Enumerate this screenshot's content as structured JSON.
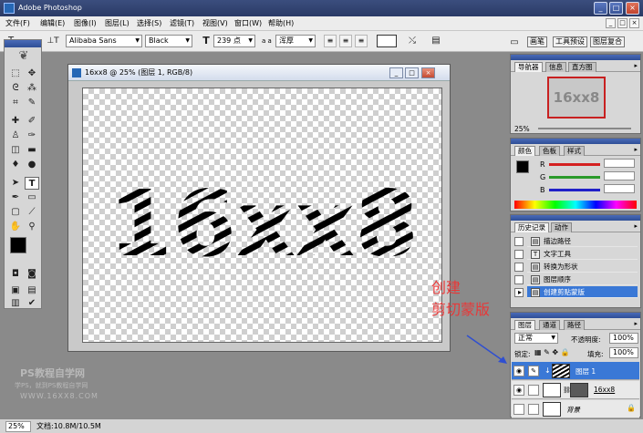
{
  "app": {
    "title": "Adobe Photoshop"
  },
  "menu": [
    "文件(F)",
    "编辑(E)",
    "图像(I)",
    "图层(L)",
    "选择(S)",
    "滤镜(T)",
    "视图(V)",
    "窗口(W)",
    "帮助(H)"
  ],
  "options": {
    "font_family": "Alibaba Sans",
    "font_style": "Black",
    "font_size": "239 点",
    "aa_label": "a a",
    "anti_alias": "浑厚"
  },
  "panel_well": [
    "画笔",
    "工具预设",
    "图层复合"
  ],
  "document": {
    "title": "16xx8 @ 25% (图层 1, RGB/8)",
    "artwork_text": "16xx8"
  },
  "navigator": {
    "tabs": [
      "导航器",
      "信息",
      "直方图"
    ],
    "zoom": "25%",
    "thumb_text": "16xx8"
  },
  "color": {
    "tabs": [
      "颜色",
      "色板",
      "样式"
    ],
    "channels": [
      {
        "label": "R",
        "value": "",
        "color": "#d42020"
      },
      {
        "label": "G",
        "value": "",
        "color": "#2a9a2a"
      },
      {
        "label": "B",
        "value": "",
        "color": "#2020c8"
      }
    ]
  },
  "history": {
    "tabs": [
      "历史记录",
      "动作"
    ],
    "items": [
      "描边路径",
      "文字工具",
      "转换为形状",
      "图层顺序",
      "创建剪贴蒙版"
    ],
    "selected_index": 4
  },
  "layers": {
    "tabs": [
      "图层",
      "通道",
      "路径"
    ],
    "blend_mode": "正常",
    "opacity_label": "不透明度:",
    "opacity": "100%",
    "lock_label": "锁定:",
    "fill_label": "填充:",
    "fill": "100%",
    "rows": [
      {
        "name": "图层 1",
        "selected": true
      },
      {
        "name": "16xx8",
        "selected": false
      },
      {
        "name": "背景",
        "selected": false
      }
    ]
  },
  "status": {
    "zoom": "25%",
    "doc_info": "文档:10.8M/10.5M"
  },
  "annotation": {
    "line1": "创建",
    "line2": "剪切蒙版"
  },
  "watermark": {
    "brand": "PS教程自学网",
    "slogan": "学PS，就到PS教程自学网",
    "url": "WWW.16XX8.COM"
  },
  "colors": {
    "accent_red": "#e83838",
    "selection_blue": "#3a78d6",
    "title_blue": "#2e4e96"
  }
}
